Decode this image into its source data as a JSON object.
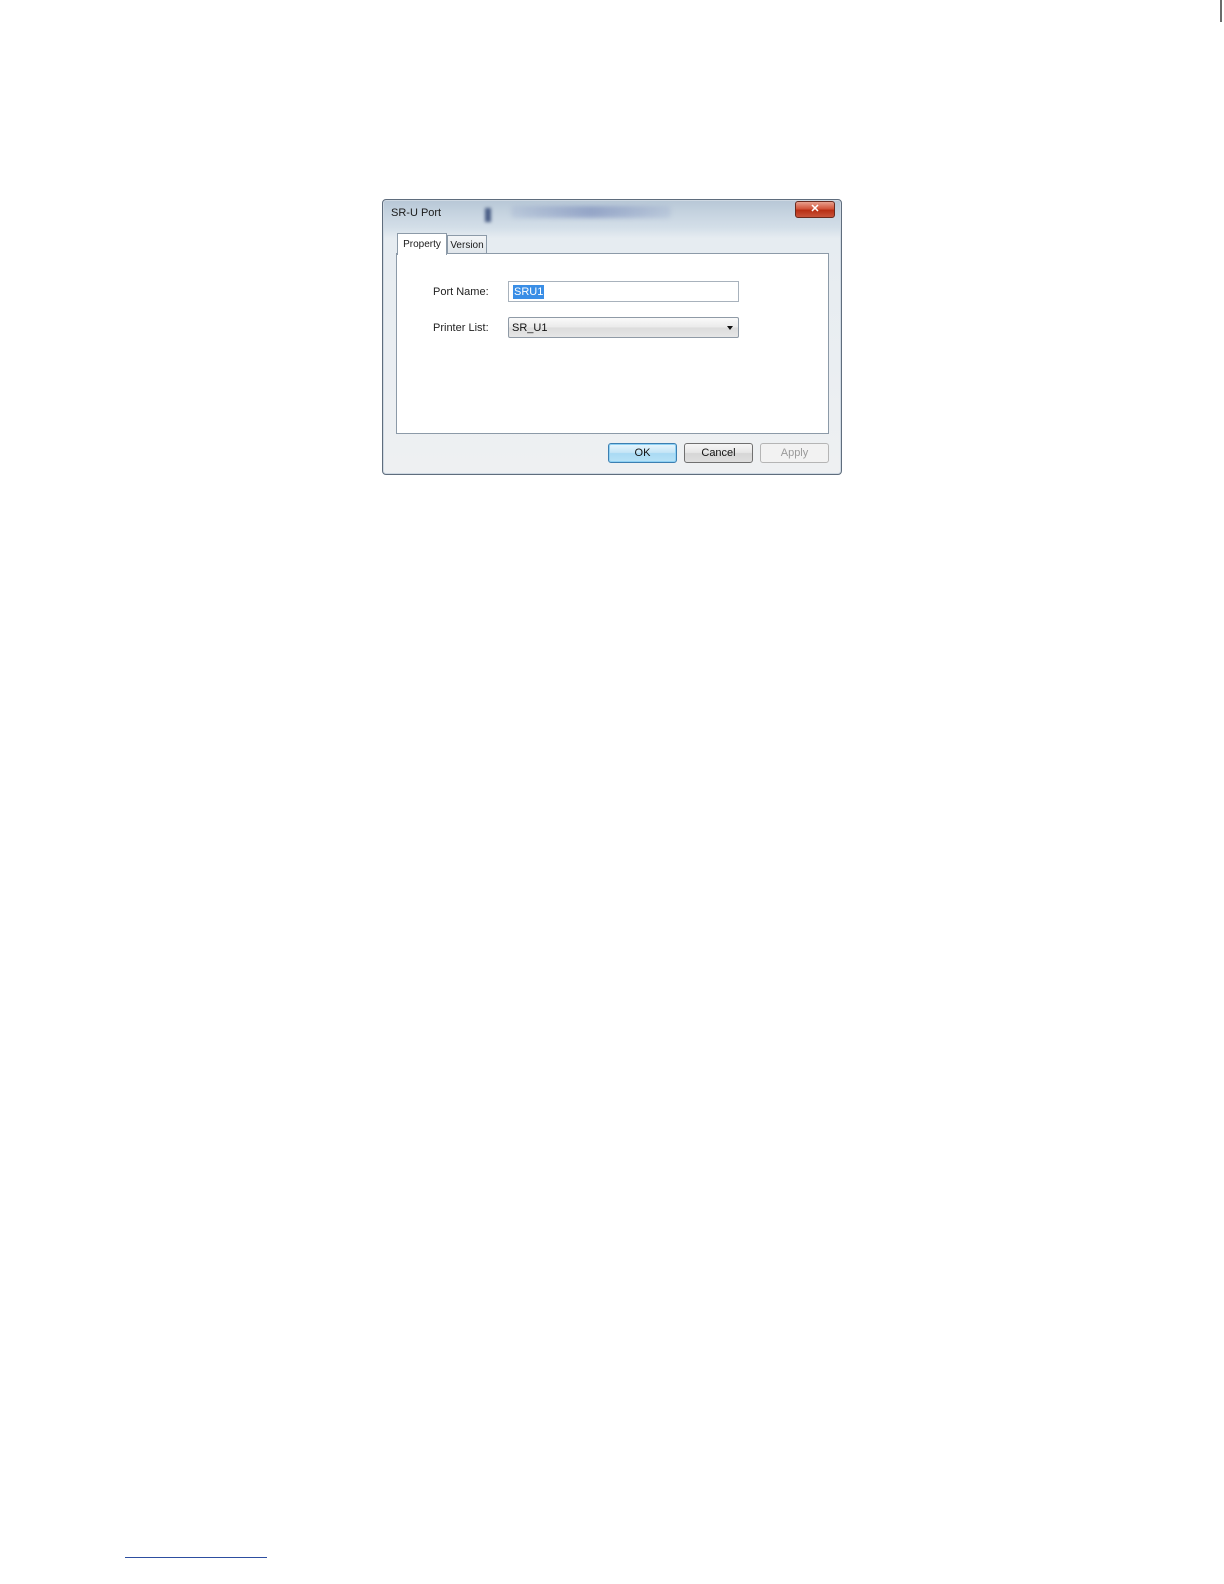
{
  "window": {
    "title": "SR-U Port",
    "close_glyph": "✕"
  },
  "tabs": [
    {
      "label": "Property",
      "active": true
    },
    {
      "label": "Version",
      "active": false
    }
  ],
  "form": {
    "port_name_label": "Port Name:",
    "port_name_value": "SRU1",
    "printer_list_label": "Printer List:",
    "printer_list_value": "SR_U1"
  },
  "buttons": {
    "ok": "OK",
    "cancel": "Cancel",
    "apply": "Apply"
  },
  "colors": {
    "selection": "#3a8ee6",
    "close_button": "#c8533a",
    "default_button": "#a9daf4"
  },
  "icons": {
    "close": "close-icon",
    "dropdown": "chevron-down-icon"
  }
}
